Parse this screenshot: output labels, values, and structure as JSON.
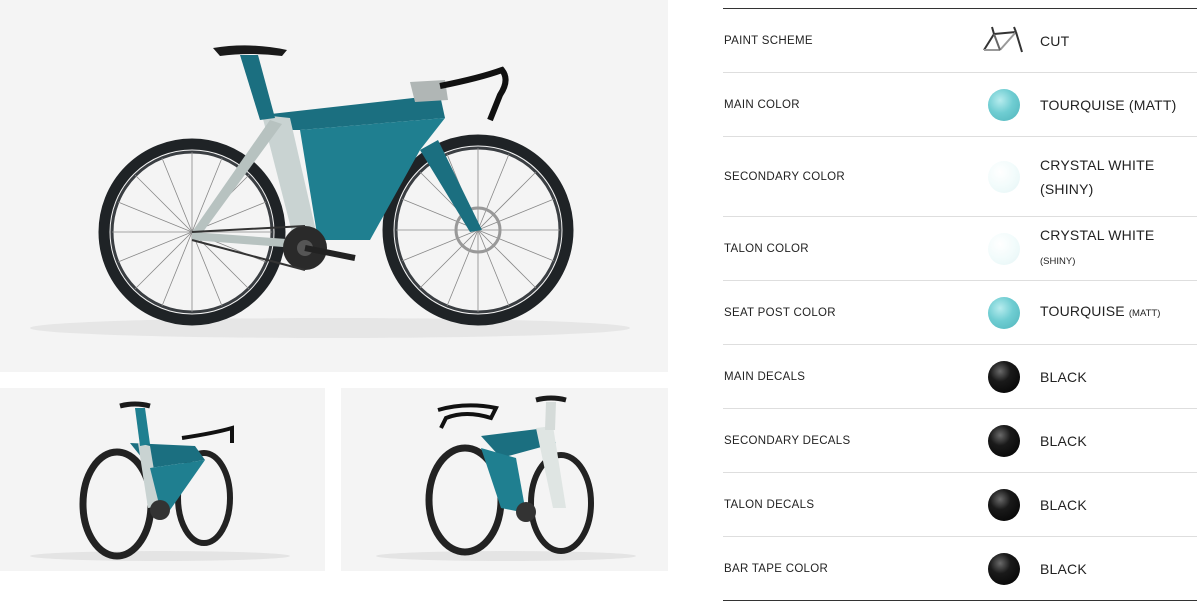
{
  "gallery": {
    "main_image_label": "Bike side view",
    "thumb_left_label": "Bike rear three-quarter view",
    "thumb_right_label": "Bike front three-quarter view"
  },
  "specs": [
    {
      "label": "PAINT SCHEME",
      "value": "CUT",
      "value_small": "",
      "swatch": "paint-scheme-icon"
    },
    {
      "label": "MAIN COLOR",
      "value": "TOURQUISE (MATT)",
      "value_small": "",
      "swatch": "turquoise",
      "color": "#6fcdd2"
    },
    {
      "label": "SECONDARY COLOR",
      "value": "CRYSTAL WHITE (SHINY)",
      "value_small": "",
      "swatch": "white",
      "color": "#f1fbfb"
    },
    {
      "label": "TALON COLOR",
      "value": "CRYSTAL WHITE ",
      "value_small": "(SHINY)",
      "swatch": "white",
      "color": "#f1fbfb"
    },
    {
      "label": "SEAT POST COLOR",
      "value": "TOURQUISE ",
      "value_small": "(MATT)",
      "swatch": "turquoise",
      "color": "#6fcdd2"
    },
    {
      "label": "MAIN DECALS",
      "value": "BLACK",
      "value_small": "",
      "swatch": "black",
      "color": "#000000"
    },
    {
      "label": "SECONDARY DECALS",
      "value": "BLACK",
      "value_small": "",
      "swatch": "black",
      "color": "#000000"
    },
    {
      "label": "TALON DECALS",
      "value": "BLACK",
      "value_small": "",
      "swatch": "black",
      "color": "#000000"
    },
    {
      "label": "BAR TAPE COLOR",
      "value": "BLACK",
      "value_small": "",
      "swatch": "black",
      "color": "#000000"
    }
  ]
}
